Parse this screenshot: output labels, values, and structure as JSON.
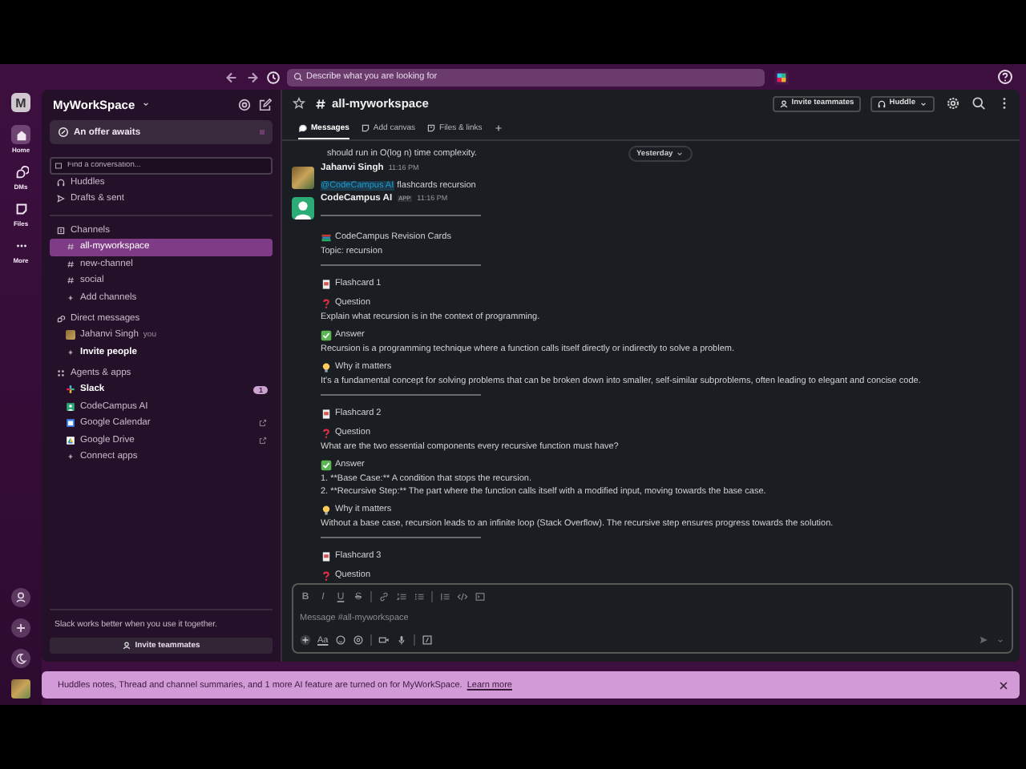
{
  "top_bar": {
    "search_placeholder": "Describe what you are looking for"
  },
  "rail": [
    {
      "label": "Home",
      "kind": "home",
      "selected": true
    },
    {
      "label": "DMs",
      "kind": "dms",
      "selected": false
    },
    {
      "label": "Files",
      "kind": "files",
      "selected": false
    },
    {
      "label": "More",
      "kind": "more",
      "selected": false
    }
  ],
  "workspace": {
    "initial": "M",
    "name": "MyWorkSpace"
  },
  "offer": "An offer awaits",
  "find_placeholder": "Find a conversation...",
  "nav": [
    {
      "label": "Huddles",
      "kind": "huddles"
    },
    {
      "label": "Drafts & sent",
      "kind": "drafts"
    }
  ],
  "sections": [
    {
      "title": "Channels",
      "kind": "channels",
      "items": [
        {
          "label": "all-myworkspace",
          "kind": "channel",
          "selected": true,
          "unread": false
        },
        {
          "label": "new-channel",
          "kind": "channel",
          "selected": false,
          "unread": false
        },
        {
          "label": "social",
          "kind": "channel",
          "selected": false,
          "unread": false
        },
        {
          "label": "Add channels",
          "kind": "add",
          "selected": false,
          "unread": false
        }
      ]
    },
    {
      "title": "Direct messages",
      "kind": "dms",
      "items": [
        {
          "label": "Jahanvi Singh",
          "kind": "person",
          "suffix": "you",
          "selected": false,
          "unread": false
        },
        {
          "label": "Invite people",
          "kind": "add",
          "selected": false,
          "unread": true
        }
      ]
    },
    {
      "title": "Agents & apps",
      "kind": "apps",
      "items": [
        {
          "label": "Slack",
          "kind": "slack",
          "badge": "1",
          "external": false,
          "selected": false,
          "unread": true
        },
        {
          "label": "CodeCampus AI",
          "kind": "bot",
          "external": false,
          "selected": false,
          "unread": false
        },
        {
          "label": "Google Calendar",
          "kind": "calendar",
          "external": true,
          "selected": false,
          "unread": false
        },
        {
          "label": "Google Drive",
          "kind": "drive",
          "external": true,
          "selected": false,
          "unread": false
        },
        {
          "label": "Connect apps",
          "kind": "add",
          "external": false,
          "selected": false,
          "unread": false
        }
      ]
    }
  ],
  "sidebar_footer": {
    "text": "Slack works better when you use it together.",
    "button": "Invite teammates"
  },
  "channel": {
    "name": "all-myworkspace",
    "invite_button": "Invite teammates",
    "huddle_button": "Huddle"
  },
  "tabs": [
    {
      "label": "Messages",
      "kind": "messages",
      "selected": true
    },
    {
      "label": "Add canvas",
      "kind": "canvas",
      "selected": false
    },
    {
      "label": "Files & links",
      "kind": "files",
      "selected": false
    }
  ],
  "earlier_text": "should run in O(log n) time complexity.",
  "date_divider": "Yesterday",
  "messages": [
    {
      "author": "Jahanvi Singh",
      "kind": "person",
      "time": "11:16 PM",
      "mention": "@CodeCampus AI",
      "text": "flashcards recursion"
    },
    {
      "author": "CodeCampus AI",
      "kind": "bot",
      "app_badge": "APP",
      "time": "11:16 PM",
      "blocks": [
        {
          "kind": "rule"
        },
        {
          "kind": "title",
          "text": "CodeCampus Revision Cards"
        },
        {
          "kind": "text",
          "text": "Topic: recursion"
        },
        {
          "kind": "rule"
        },
        {
          "kind": "card",
          "text": "Flashcard 1"
        },
        {
          "kind": "question",
          "text": "Question"
        },
        {
          "kind": "text",
          "text": "Explain what recursion is in the context of programming."
        },
        {
          "kind": "answer",
          "text": "Answer"
        },
        {
          "kind": "text",
          "text": "Recursion is a programming technique where a function calls itself directly or indirectly to solve a problem."
        },
        {
          "kind": "why",
          "text": "Why it matters"
        },
        {
          "kind": "text",
          "text": "It's a fundamental concept for solving problems that can be broken down into smaller, self-similar subproblems, often leading to elegant and concise code."
        },
        {
          "kind": "rule"
        },
        {
          "kind": "card",
          "text": "Flashcard 2"
        },
        {
          "kind": "question",
          "text": "Question"
        },
        {
          "kind": "text",
          "text": "What are the two essential components every recursive function must have?"
        },
        {
          "kind": "answer",
          "text": "Answer"
        },
        {
          "kind": "text",
          "text": "1. **Base Case:** A condition that stops the recursion."
        },
        {
          "kind": "text",
          "text": "2. **Recursive Step:** The part where the function calls itself with a modified input, moving towards the base case."
        },
        {
          "kind": "why",
          "text": "Why it matters"
        },
        {
          "kind": "text",
          "text": "Without a base case, recursion leads to an infinite loop (Stack Overflow). The recursive step ensures progress towards the solution."
        },
        {
          "kind": "rule"
        },
        {
          "kind": "card",
          "text": "Flashcard 3"
        },
        {
          "kind": "question",
          "text": "Question"
        }
      ]
    }
  ],
  "composer": {
    "format_buttons": [
      {
        "label": "B",
        "kind": "bold"
      },
      {
        "label": "I",
        "kind": "italic"
      },
      {
        "label": "U",
        "kind": "underline"
      },
      {
        "label": "S",
        "kind": "strike"
      }
    ],
    "text_format_label": "Aa",
    "placeholder": "Message #all-myworkspace"
  },
  "banner": {
    "text": "Huddles notes, Thread and channel summaries, and 1 more AI feature are turned on for MyWorkSpace.",
    "link": "Learn more"
  }
}
